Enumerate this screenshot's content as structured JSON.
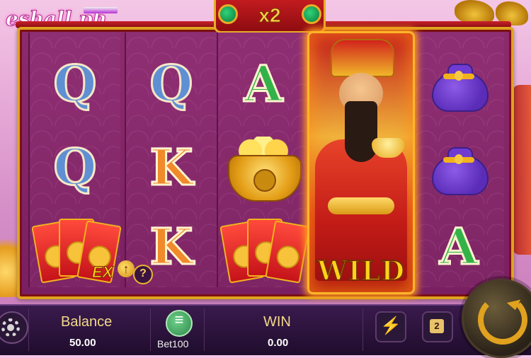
{
  "brand": {
    "name": "eshall.ph"
  },
  "header": {
    "multiplier": "x2"
  },
  "reels": [
    {
      "symbols": [
        "Q",
        "Q",
        "red-envelopes"
      ]
    },
    {
      "symbols": [
        "Q",
        "K",
        "K"
      ]
    },
    {
      "symbols": [
        "A",
        "gold-pot",
        "red-envelopes"
      ]
    },
    {
      "symbols": [
        "wild-fortune-god"
      ]
    },
    {
      "symbols": [
        "money-bag",
        "money-bag",
        "A"
      ]
    }
  ],
  "wild": {
    "label": "WILD"
  },
  "feature": {
    "ex_label": "EX",
    "help_label": "?"
  },
  "status": {
    "balance_label": "Balance",
    "balance_value": "50.00",
    "bet_label": "Bet",
    "bet_value": "100",
    "win_label": "WIN",
    "win_value": "0.00"
  },
  "controls": {
    "turbo_icon": "lightning-icon",
    "auto_count": "2",
    "spin_icon": "spin-arrow-icon",
    "settings_icon": "gear-icon"
  },
  "colors": {
    "frame_gold": "#e0a21f",
    "reel_purple": "#7e2565",
    "bar_dark": "#1f0d2c",
    "label_gold": "#f2d98a"
  }
}
